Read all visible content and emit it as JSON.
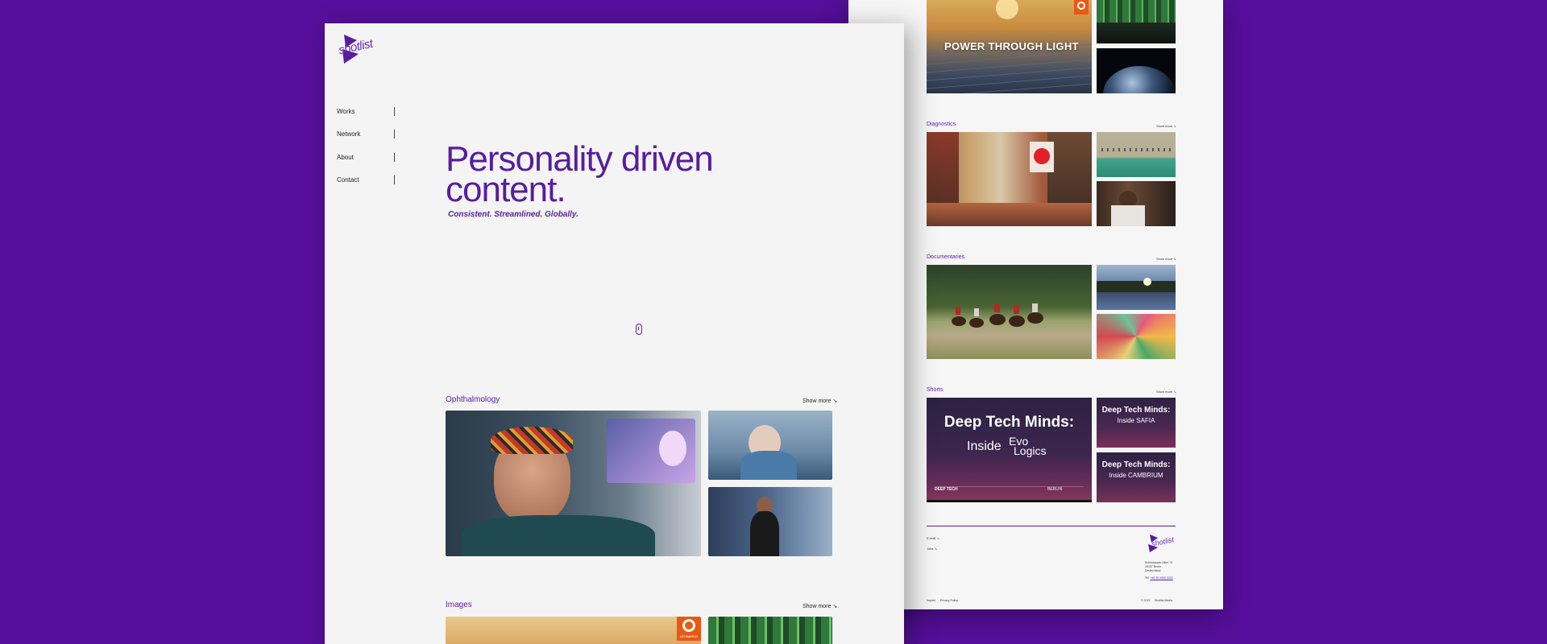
{
  "brand": {
    "name": "shotlist"
  },
  "front": {
    "nav": [
      {
        "label": "Works"
      },
      {
        "label": "Network"
      },
      {
        "label": "About"
      },
      {
        "label": "Contact"
      }
    ],
    "hero": {
      "title_line1": "Personality driven",
      "title_line2": "content.",
      "subtitle": "Consistent. Streamlined. Globally."
    },
    "sections": [
      {
        "label": "Ophthalmology",
        "show_more": "Show more ↘"
      },
      {
        "label": "Images",
        "show_more": "Show more ↘"
      }
    ],
    "badge_text": "LEONARDO"
  },
  "back": {
    "hero_caption": "POWER THROUGH LIGHT",
    "sections": [
      {
        "label": "Diagnostics",
        "show_more": "Show more ↘"
      },
      {
        "label": "Documentaries",
        "show_more": "Show more ↘"
      },
      {
        "label": "Shorts",
        "show_more": "Show more ↘"
      }
    ],
    "shorts": {
      "main_line1": "Deep Tech Minds:",
      "main_inside": "Inside",
      "main_brand_top": "Evo",
      "main_brand_bottom": "Logics",
      "main_footer_left": "DEEP TECH",
      "main_footer_right": "BERLIN",
      "small1_line1": "Deep Tech Minds:",
      "small1_line2": "Inside SAFIA",
      "small2_line1": "Deep Tech Minds:",
      "small2_line2": "Inside CAMBRIUM"
    },
    "footer": {
      "link1": "E-mail ↘",
      "link2": "Jobs ↘",
      "address1": "Schönhauser Allee 74",
      "address2": "10437 Berlin",
      "address3": "Deutschland",
      "phone_prefix": "Tel.",
      "phone": "+49 30 0000 0000",
      "legal1": "Imprint",
      "legal2": "Privacy Policy",
      "copyright": "© 2023",
      "credit": "Shotlist Media"
    }
  },
  "colors": {
    "background": "#560f9c",
    "accent": "#571d9e",
    "page": "#f4f4f4"
  }
}
